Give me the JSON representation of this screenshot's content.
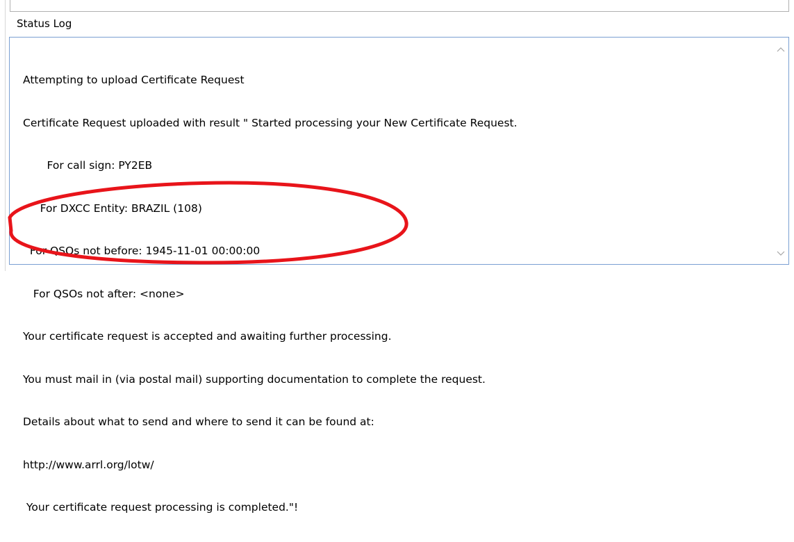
{
  "section": {
    "label": "Status Log"
  },
  "log": {
    "lines": [
      "Attempting to upload Certificate Request",
      "Certificate Request uploaded with result \" Started processing your New Certificate Request.",
      "       For call sign: PY2EB",
      "     For DXCC Entity: BRAZIL (108)",
      "  For QSOs not before: 1945-11-01 00:00:00",
      "   For QSOs not after: <none>",
      "Your certificate request is accepted and awaiting further processing.",
      "You must mail in (via postal mail) supporting documentation to complete the request.",
      "Details about what to send and where to send it can be found at:",
      "http://www.arrl.org/lotw/",
      " Your certificate request processing is completed.\"!"
    ]
  },
  "scrollbar": {
    "up_icon": "chevron-up-icon",
    "down_icon": "chevron-down-icon"
  },
  "annotation": {
    "shape": "ellipse",
    "color": "#e8141a"
  }
}
